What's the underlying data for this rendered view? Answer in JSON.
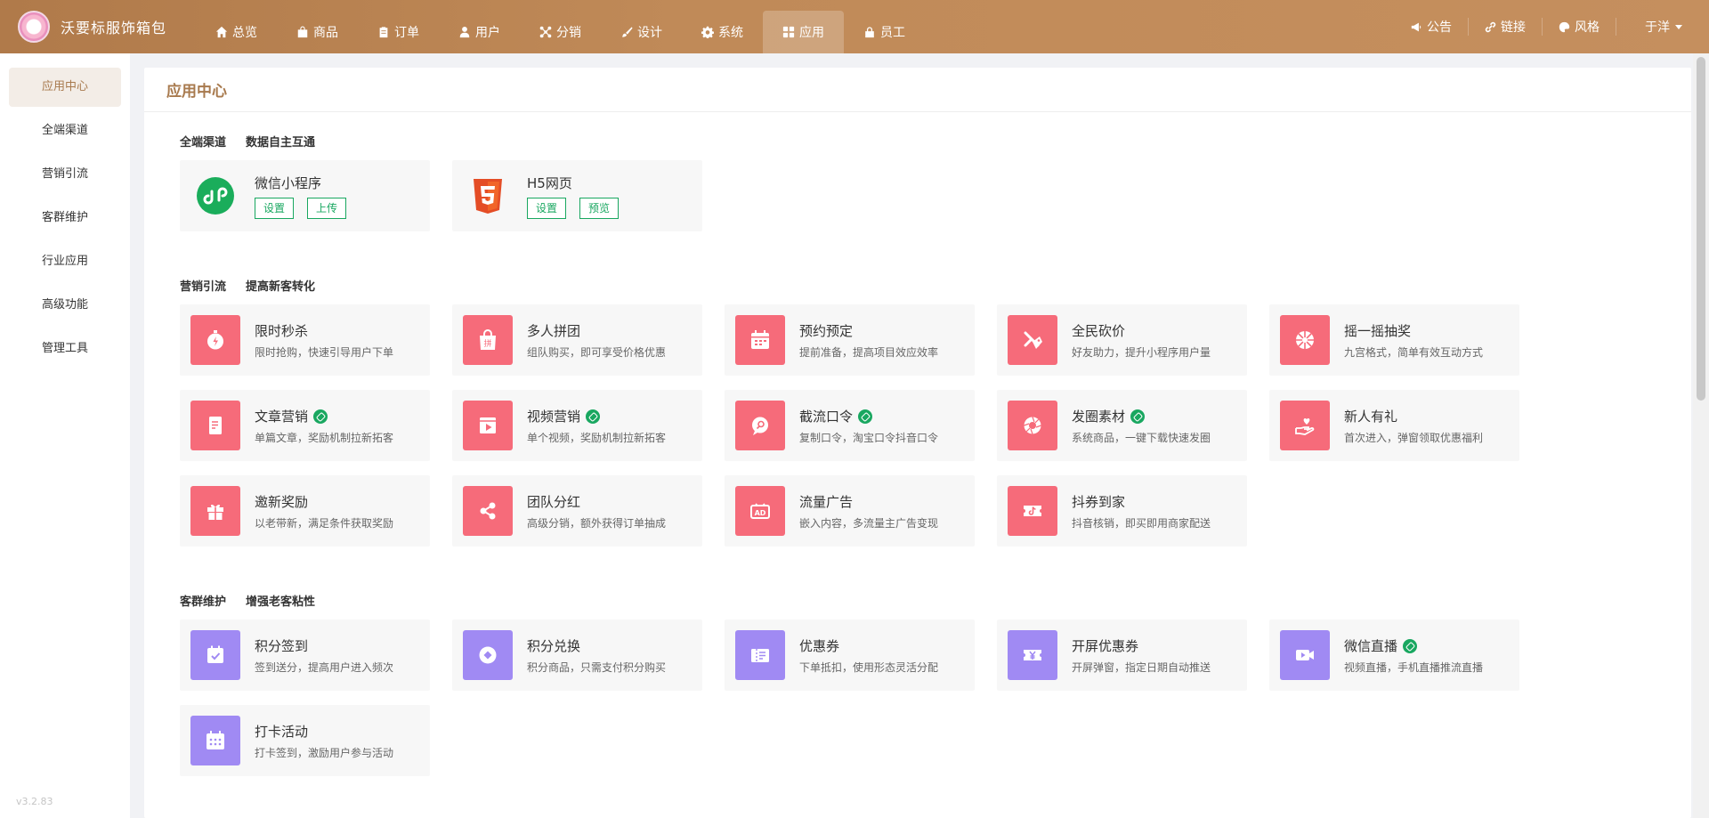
{
  "brand": {
    "name": "沃要标服饰箱包"
  },
  "nav": [
    {
      "label": "总览",
      "icon": "home-icon"
    },
    {
      "label": "商品",
      "icon": "bag-icon"
    },
    {
      "label": "订单",
      "icon": "clipboard-icon"
    },
    {
      "label": "用户",
      "icon": "user-icon"
    },
    {
      "label": "分销",
      "icon": "network-icon"
    },
    {
      "label": "设计",
      "icon": "brush-icon"
    },
    {
      "label": "系统",
      "icon": "gear-icon"
    },
    {
      "label": "应用",
      "icon": "grid-icon",
      "active": true
    },
    {
      "label": "员工",
      "icon": "lock-icon"
    }
  ],
  "top_right": {
    "notice": "公告",
    "link": "链接",
    "style": "风格",
    "user": "于洋"
  },
  "sidebar": {
    "items": [
      "应用中心",
      "全端渠道",
      "营销引流",
      "客群维护",
      "行业应用",
      "高级功能",
      "管理工具"
    ],
    "version": "v3.2.83"
  },
  "main": {
    "title": "应用中心"
  },
  "sections": {
    "channels": {
      "title": "全端渠道",
      "subtitle": "数据自主互通",
      "cards": [
        {
          "name": "微信小程序",
          "icon": "wechat-miniprogram-icon",
          "buttons": [
            "设置",
            "上传"
          ]
        },
        {
          "name": "H5网页",
          "icon": "html5-icon",
          "buttons": [
            "设置",
            "预览"
          ]
        }
      ]
    },
    "marketing": {
      "title": "营销引流",
      "subtitle": "提高新客转化",
      "cards": [
        {
          "name": "限时秒杀",
          "desc": "限时抢购，快速引导用户下单",
          "icon": "stopwatch-icon"
        },
        {
          "name": "多人拼团",
          "desc": "组队购买，即可享受价格优惠",
          "icon": "group-buy-icon"
        },
        {
          "name": "预约预定",
          "desc": "提前准备，提高项目效应效率",
          "icon": "calendar-icon"
        },
        {
          "name": "全民砍价",
          "desc": "好友助力，提升小程序用户量",
          "icon": "bargain-icon"
        },
        {
          "name": "摇一摇抽奖",
          "desc": "九宫格式，简单有效互动方式",
          "icon": "wheel-icon"
        },
        {
          "name": "文章营销",
          "desc": "单篇文章，奖励机制拉新拓客",
          "icon": "article-icon",
          "badge": true
        },
        {
          "name": "视频营销",
          "desc": "单个视频，奖励机制拉新拓客",
          "icon": "video-icon",
          "badge": true
        },
        {
          "name": "截流口令",
          "desc": "复制口令，淘宝口令抖音口令",
          "icon": "search-bubble-icon",
          "badge": true
        },
        {
          "name": "发圈素材",
          "desc": "系统商品，一键下载快速发圈",
          "icon": "aperture-icon",
          "badge": true
        },
        {
          "name": "新人有礼",
          "desc": "首次进入，弹窗领取优惠福利",
          "icon": "heart-hand-icon"
        },
        {
          "name": "邀新奖励",
          "desc": "以老带新，满足条件获取奖励",
          "icon": "gift-icon"
        },
        {
          "name": "团队分红",
          "desc": "高级分销，额外获得订单抽成",
          "icon": "share-icon"
        },
        {
          "name": "流量广告",
          "desc": "嵌入内容，多流量主广告变现",
          "icon": "ad-icon"
        },
        {
          "name": "抖券到家",
          "desc": "抖音核销，即买即用商家配送",
          "icon": "douyin-ticket-icon"
        }
      ]
    },
    "retention": {
      "title": "客群维护",
      "subtitle": "增强老客粘性",
      "cards": [
        {
          "name": "积分签到",
          "desc": "签到送分，提高用户进入频次",
          "icon": "checkin-icon"
        },
        {
          "name": "积分兑换",
          "desc": "积分商品，只需支付积分购买",
          "icon": "points-icon"
        },
        {
          "name": "优惠券",
          "desc": "下单抵扣，使用形态灵活分配",
          "icon": "coupon-icon"
        },
        {
          "name": "开屏优惠券",
          "desc": "开屏弹窗，指定日期自动推送",
          "icon": "yen-ticket-icon"
        },
        {
          "name": "微信直播",
          "desc": "视频直播，手机直播推流直播",
          "icon": "live-icon",
          "badge": true
        },
        {
          "name": "打卡活动",
          "desc": "打卡签到，激励用户参与活动",
          "icon": "punch-calendar-icon"
        }
      ]
    }
  },
  "colors": {
    "topbar": "#c08a58",
    "accent": "#a87a4e",
    "marketing_icon": "#f66b7a",
    "retention_icon": "#a08af3",
    "green": "#19a760"
  }
}
